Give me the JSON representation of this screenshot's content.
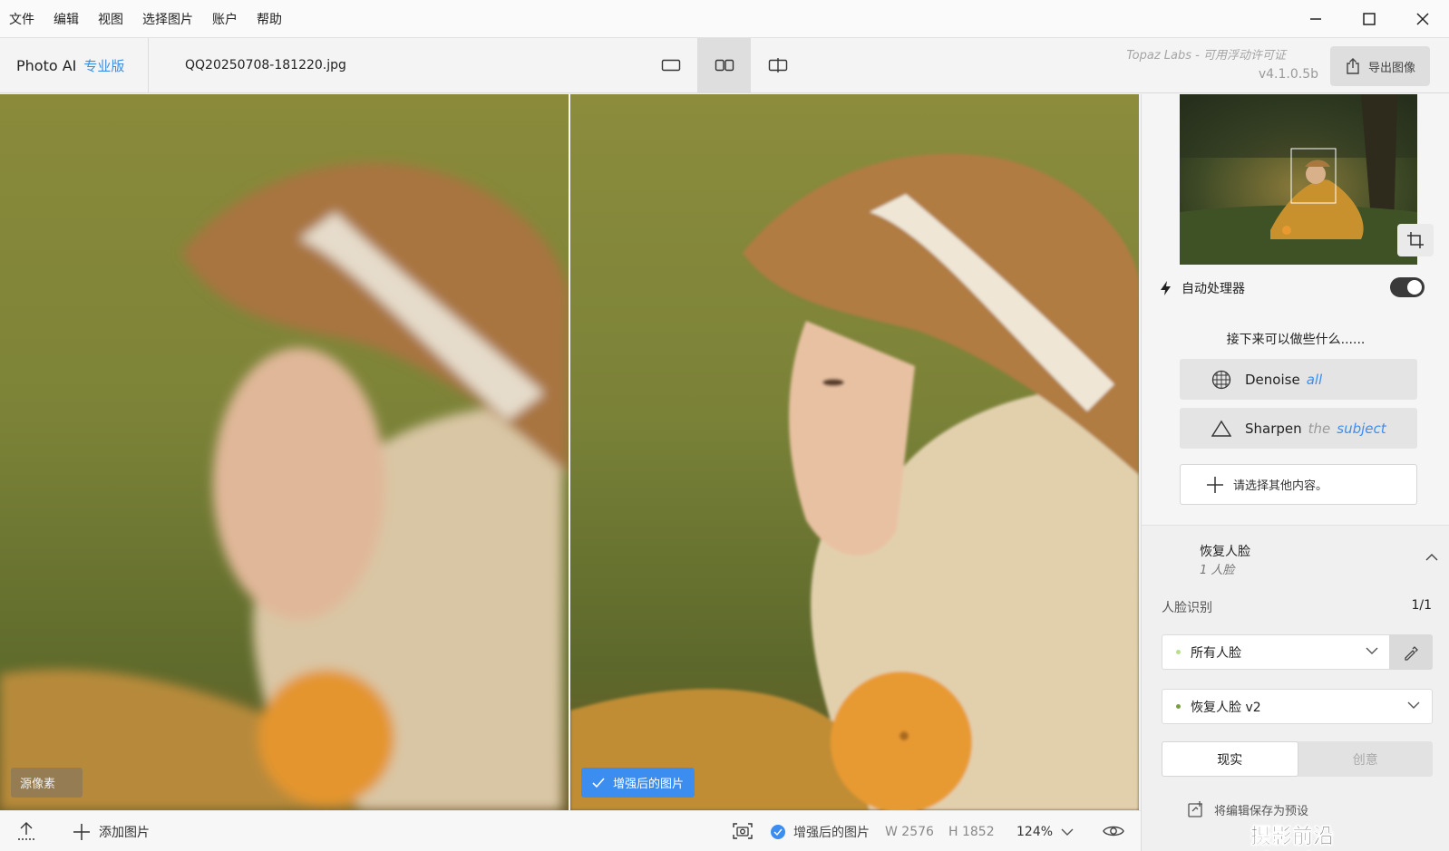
{
  "menu": {
    "items": [
      "文件",
      "编辑",
      "视图",
      "选择图片",
      "账户",
      "帮助"
    ]
  },
  "window_controls": [
    "minimize-icon",
    "maximize-icon",
    "close-icon"
  ],
  "header": {
    "app_name": "Photo AI",
    "edition": "专业版",
    "filename": "QQ20250708-181220.jpg",
    "view_modes": [
      "single-view-icon",
      "side-by-side-icon",
      "split-view-icon"
    ],
    "active_view_mode": "side-by-side-icon",
    "license": "Topaz Labs - 可用浮动许可证",
    "version": "v4.1.0.5b",
    "export_label": "导出图像"
  },
  "preview": {
    "left_label": "源像素",
    "right_label": "增强后的图片"
  },
  "statusbar": {
    "add_label": "添加图片",
    "enhanced_label": "增强后的图片",
    "width": "W 2576",
    "height": "H 1852",
    "zoom": "124%"
  },
  "sidebar": {
    "auto_label": "自动处理器",
    "auto_enabled": true,
    "next_title": "接下来可以做些什么......",
    "suggestions": [
      {
        "name": "Denoise",
        "mod": "",
        "target": "all",
        "icon": "denoise-icon"
      },
      {
        "name": "Sharpen",
        "mod": "the",
        "target": "subject",
        "icon": "sharpen-icon"
      }
    ],
    "more_label": "请选择其他内容。",
    "face": {
      "title": "恢复人脸",
      "count": "1 人脸",
      "detect_label": "人脸识别",
      "detect_value": "1/1",
      "faces_option": "所有人脸",
      "model_option": "恢复人脸 v2",
      "modes": [
        "现实",
        "创意"
      ],
      "active_mode": "现实",
      "save_label": "将编辑保存为预设"
    }
  },
  "watermark": "摄影前沿 sheyingzyz.com",
  "colors": {
    "accent": "#3b8ef0",
    "toggle_on": "#3a3a3a"
  }
}
